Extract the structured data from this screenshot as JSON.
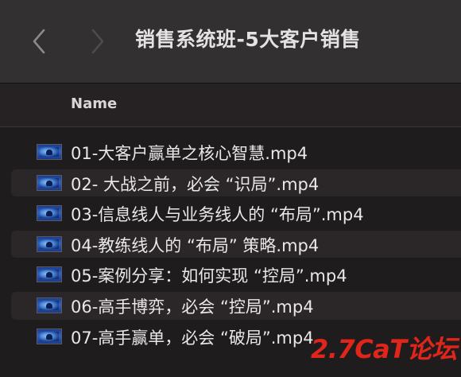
{
  "window": {
    "title": "销售系统班-5大客户销售",
    "back_icon": "chevron-left-icon",
    "forward_icon": "chevron-right-icon"
  },
  "list": {
    "column_header": "Name",
    "files": [
      {
        "name": "01-大客户赢单之核心智慧.mp4"
      },
      {
        "name": "02- 大战之前，必会 “识局”.mp4"
      },
      {
        "name": "03-信息线人与业务线人的 “布局”.mp4"
      },
      {
        "name": "04-教练线人的 “布局” 策略.mp4"
      },
      {
        "name": "05-案例分享：如何实现 “控局”.mp4"
      },
      {
        "name": "06-高手博弈，必会 “控局”.mp4"
      },
      {
        "name": "07-高手赢单，必会 “破局”.mp4"
      }
    ]
  },
  "watermark": {
    "text": "2.7CaT论坛",
    "color": "#e1251b"
  }
}
